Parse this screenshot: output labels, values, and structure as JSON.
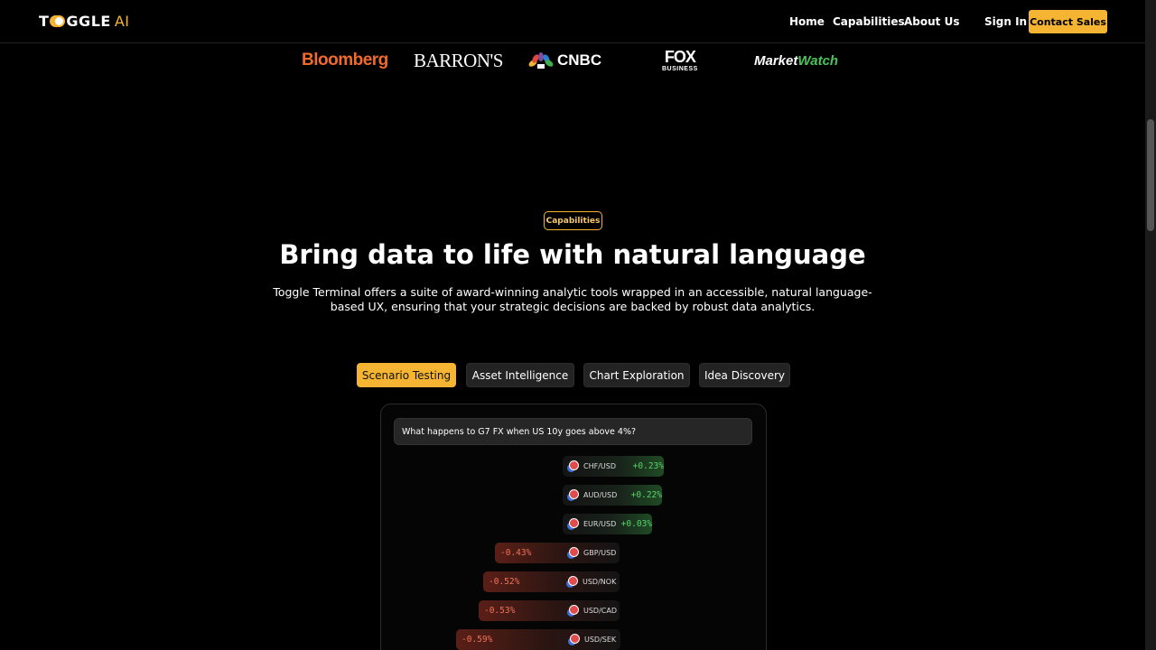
{
  "nav": {
    "logo_t": "T",
    "logo_rest": "GGLE",
    "logo_ai": "AI",
    "links": [
      "Home",
      "Capabilities",
      "About Us"
    ],
    "sign_in": "Sign In",
    "contact": "Contact Sales"
  },
  "press": {
    "bloomberg": "Bloomberg",
    "barrons": "BARRON'S",
    "cnbc": "CNBC",
    "fox_top": "FOX",
    "fox_bottom": "BUSINESS",
    "mw_market": "Market",
    "mw_watch": "Watch"
  },
  "section": {
    "badge": "Capabilities",
    "headline": "Bring data to life with natural language",
    "subtext": "Toggle Terminal offers a suite of award-winning analytic tools wrapped in an accessible, natural language-based UX, ensuring that your strategic decisions are backed by robust data analytics."
  },
  "tabs": [
    "Scenario Testing",
    "Asset Intelligence",
    "Chart Exploration",
    "Idea Discovery"
  ],
  "active_tab": "Scenario Testing",
  "demo": {
    "query": "What happens to G7 FX when US 10y goes above 4%?",
    "results": [
      {
        "pair": "CHF/USD",
        "change": "+0.23%"
      },
      {
        "pair": "AUD/USD",
        "change": "+0.22%"
      },
      {
        "pair": "EUR/USD",
        "change": "+0.03%"
      },
      {
        "pair": "GBP/USD",
        "change": "-0.43%"
      },
      {
        "pair": "USD/NOK",
        "change": "-0.52%"
      },
      {
        "pair": "USD/CAD",
        "change": "-0.53%"
      },
      {
        "pair": "USD/SEK",
        "change": "-0.59%"
      }
    ]
  },
  "colors": {
    "accent": "#f5b431",
    "positive": "#58d36a",
    "negative": "#f0735a",
    "bloomberg": "#f26a2a",
    "marketwatch": "#4cc35a"
  }
}
